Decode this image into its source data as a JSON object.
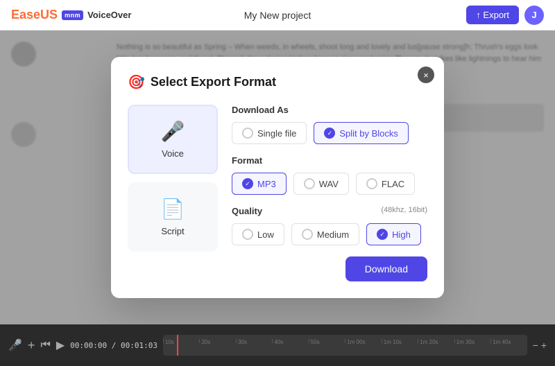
{
  "topbar": {
    "logo_ease": "Ease",
    "logo_us": "US",
    "logo_mnm": "mnm",
    "logo_voiceover": "VoiceOver",
    "project_title": "My New project",
    "export_button_label": "↑ Export",
    "avatar_label": "J"
  },
  "background": {
    "text": "Nothing is so beautiful as Spring – When weeds, in wheels, shoot long and lovely and lus[pause strong]h; Thrush's eggs look little low heavens, and thrush Through the echoing timber does so rinse and wring The ear, it strikes like lightnings to hear him sing; The glassy peartree leaves and blooms, they brush The"
  },
  "modal": {
    "title": "Select Export Format",
    "close_label": "×",
    "left_cards": [
      {
        "id": "voice",
        "label": "Voice",
        "icon": "🎤",
        "active": true
      },
      {
        "id": "script",
        "label": "Script",
        "icon": "📄",
        "active": false
      }
    ],
    "download_as_section": {
      "title": "Download As",
      "options": [
        {
          "id": "single",
          "label": "Single file",
          "selected": false
        },
        {
          "id": "split",
          "label": "Split by Blocks",
          "selected": true
        }
      ]
    },
    "format_section": {
      "title": "Format",
      "options": [
        {
          "id": "mp3",
          "label": "MP3",
          "selected": true
        },
        {
          "id": "wav",
          "label": "WAV",
          "selected": false
        },
        {
          "id": "flac",
          "label": "FLAC",
          "selected": false
        }
      ]
    },
    "quality_section": {
      "title": "Quality",
      "hint": "(48khz,  16bit)",
      "options": [
        {
          "id": "low",
          "label": "Low",
          "selected": false
        },
        {
          "id": "medium",
          "label": "Medium",
          "selected": false
        },
        {
          "id": "high",
          "label": "High",
          "selected": true
        }
      ]
    },
    "download_button": "Download"
  },
  "timeline": {
    "time_display": "00:00:00 / 00:01:03",
    "marks": [
      "10s",
      "20s",
      "30s",
      "40s",
      "50s",
      "1m 00s",
      "1m 10s",
      "1m 20s",
      "1m 30s",
      "1m 40s"
    ]
  }
}
